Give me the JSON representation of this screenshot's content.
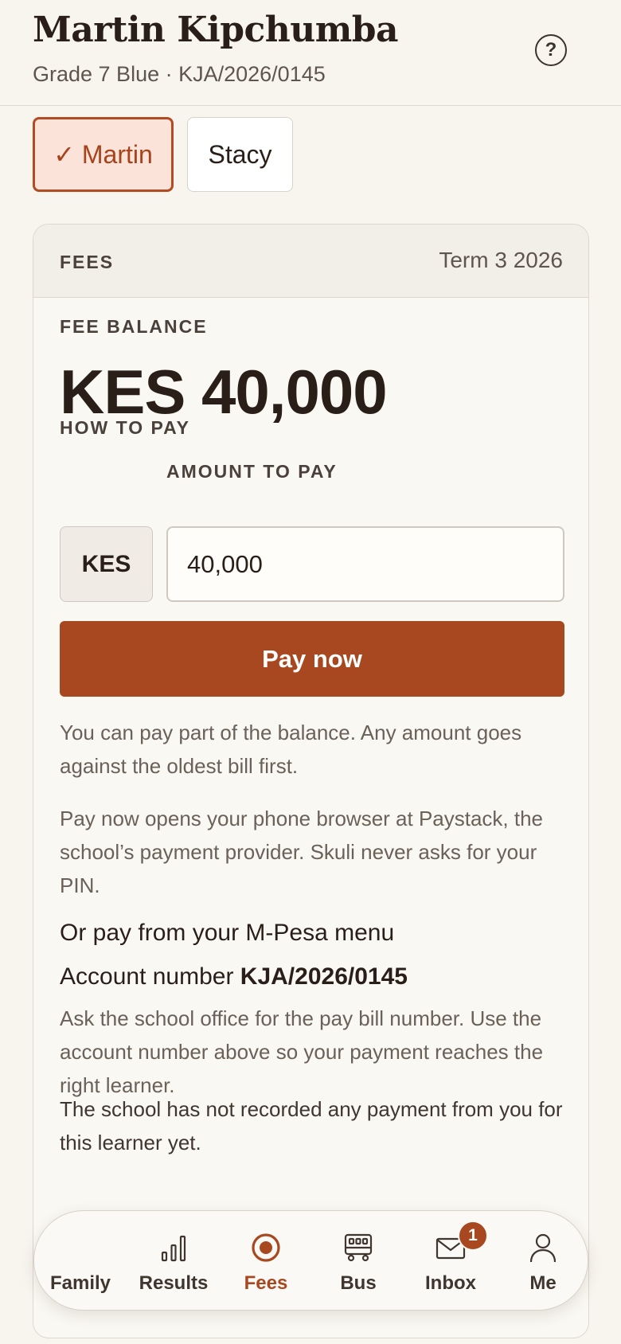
{
  "header": {
    "learner_name": "Martin Kipchumba",
    "learner_sub": "Grade 7 Blue · KJA/2026/0145",
    "help_glyph": "?"
  },
  "learner_tabs": [
    {
      "label": "✓ Martin",
      "selected": true
    },
    {
      "label": "Stacy",
      "selected": false
    }
  ],
  "fees_card": {
    "section_label": "FEES",
    "term": "Term 3 2026",
    "balance_label": "FEE BALANCE",
    "balance_value": "KES 40,000",
    "how_to_pay_label": "HOW TO PAY",
    "amount_label": "AMOUNT TO PAY",
    "currency": "KES",
    "amount_value": "40,000",
    "pay_button": "Pay now",
    "partial_note": "You can pay part of the balance. Any amount goes against the oldest bill first.",
    "paystack_note": "Pay now opens your phone browser at Paystack, the school’s payment provider. Skuli never asks for your PIN.",
    "mpesa_heading": "Or pay from your M-Pesa menu",
    "account_prefix": "Account number",
    "account_number": "KJA/2026/0145",
    "paybill_note": "Ask the school office for the pay bill number. Use the account number above so your payment reaches the right learner.",
    "payment_status": "The school has not recorded any payment from you for this learner yet."
  },
  "bottom_nav": {
    "items": [
      {
        "label": "Family",
        "icon": "family-icon",
        "active": false
      },
      {
        "label": "Results",
        "icon": "bar-chart-icon",
        "active": false
      },
      {
        "label": "Fees",
        "icon": "target-icon",
        "active": true
      },
      {
        "label": "Bus",
        "icon": "bus-icon",
        "active": false
      },
      {
        "label": "Inbox",
        "icon": "mail-icon",
        "active": false,
        "badge": "1"
      },
      {
        "label": "Me",
        "icon": "person-icon",
        "active": false
      }
    ]
  },
  "colors": {
    "accent": "#a84820",
    "background": "#f8f5ef",
    "selected_tab_bg": "#fbe3d9"
  }
}
